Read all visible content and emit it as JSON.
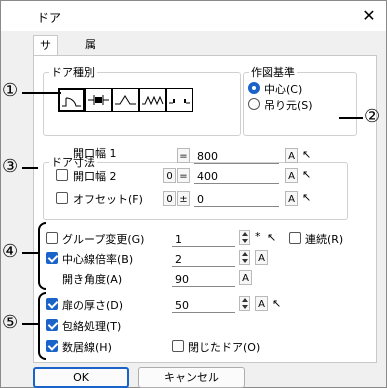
{
  "dialog": {
    "title": "ドア",
    "close_glyph": "✕"
  },
  "tabs": [
    {
      "label": "サイズ",
      "active": true
    },
    {
      "label": "属性",
      "active": false
    }
  ],
  "door_type": {
    "legend": "ドア種別",
    "selected_index": 0,
    "count": 5
  },
  "base": {
    "legend": "作図基準",
    "options": [
      {
        "label": "中心(C)",
        "checked": true
      },
      {
        "label": "吊り元(S)",
        "checked": false
      }
    ]
  },
  "dimensions": {
    "legend": "ドア寸法",
    "opening1": {
      "label": "開口幅 1",
      "op": "=",
      "value": "800"
    },
    "opening2": {
      "label": "開口幅 2",
      "checked": false,
      "prefix": "0",
      "op": "=",
      "value": "400"
    },
    "offset": {
      "label": "オフセット(F)",
      "checked": false,
      "prefix": "0",
      "op": "±",
      "value": "0"
    }
  },
  "group": {
    "change_label": "グループ変更(G)",
    "change_checked": false,
    "change_value": "1",
    "star": "*",
    "continuous_label": "連続(R)",
    "continuous_checked": false,
    "center_scale_label": "中心線倍率(B)",
    "center_scale_checked": true,
    "center_scale_value": "2",
    "open_angle_label": "開き角度(A)",
    "open_angle_value": "90"
  },
  "opts": {
    "thickness_label": "扉の厚さ(D)",
    "thickness_checked": true,
    "thickness_value": "50",
    "wrap_label": "包絡処理(T)",
    "wrap_checked": true,
    "count_label": "数居線(H)",
    "count_checked": true,
    "closed_label": "閉じたドア(O)",
    "closed_checked": false
  },
  "buttons": {
    "ok": "OK",
    "cancel": "キャンセル"
  },
  "callouts": [
    "①",
    "②",
    "③",
    "④",
    "⑤"
  ],
  "icon_glyphs": {
    "a": "A",
    "cursor": "↖"
  }
}
